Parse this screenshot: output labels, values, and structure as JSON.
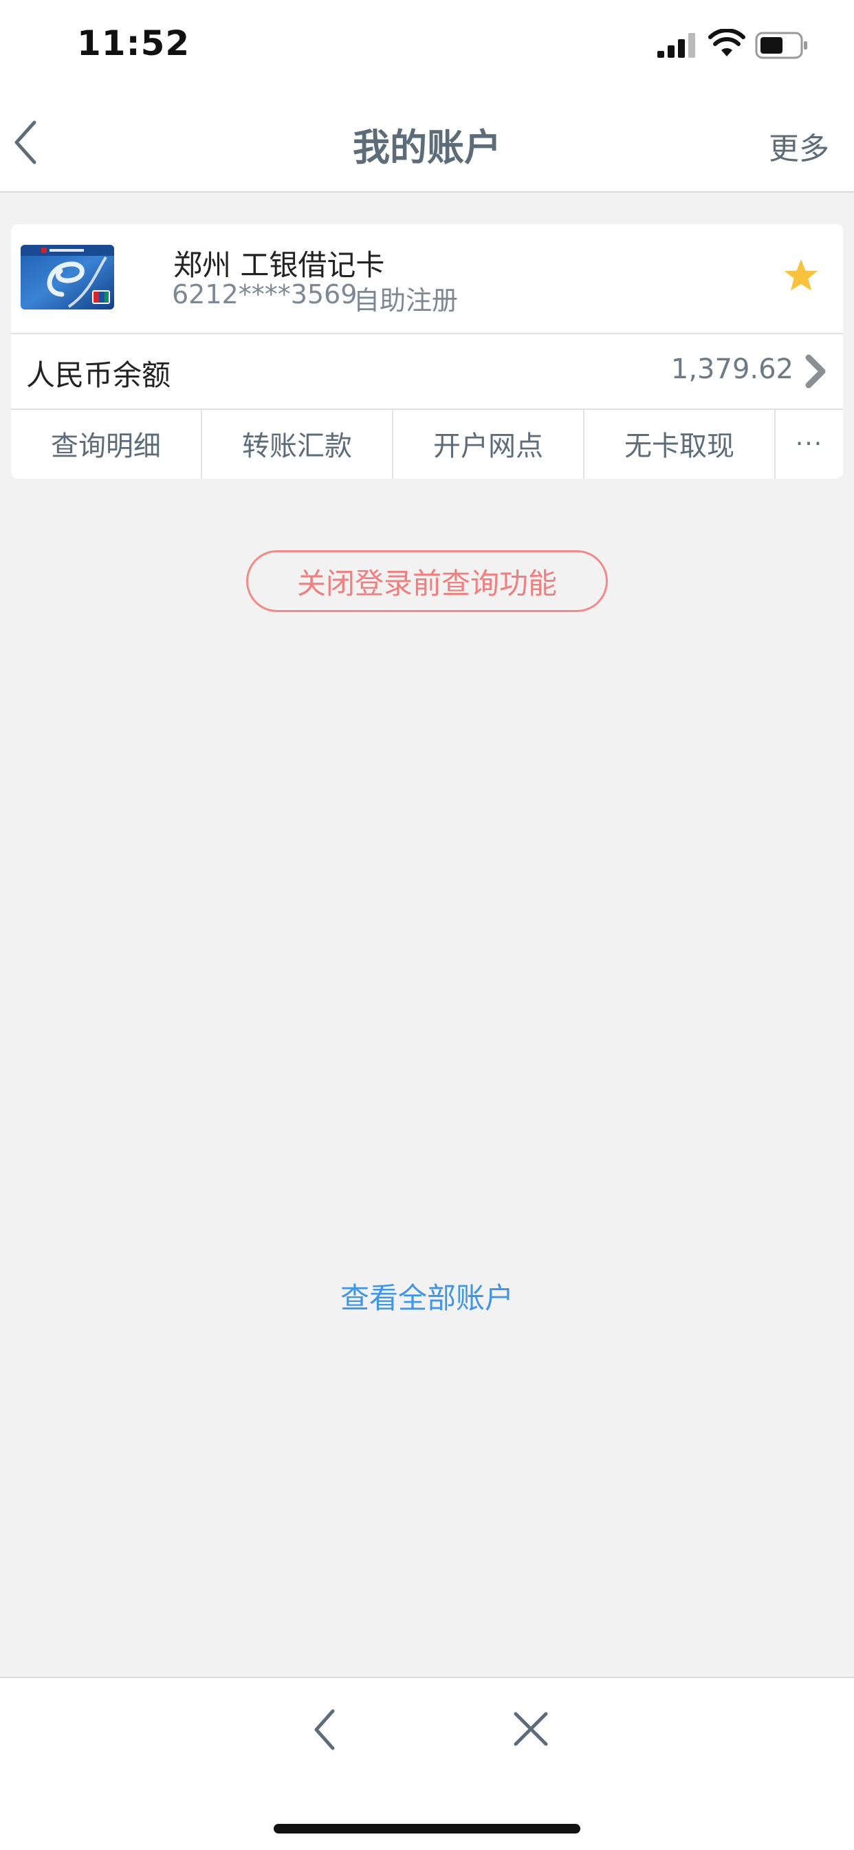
{
  "status_bar": {
    "time": "11:52"
  },
  "header": {
    "title": "我的账户",
    "more_label": "更多"
  },
  "account_card": {
    "name": "郑州 工银借记卡",
    "number": "6212****3569",
    "registration": "自助注册",
    "favorite": true,
    "balance_label": "人民币余额",
    "balance_value": "1,379.62",
    "actions": [
      {
        "label": "查询明细"
      },
      {
        "label": "转账汇款"
      },
      {
        "label": "开户网点"
      },
      {
        "label": "无卡取现"
      },
      {
        "label": "···"
      }
    ]
  },
  "close_query_button": "关闭登录前查询功能",
  "view_all_link": "查看全部账户",
  "icons": {
    "back": "chevron-left-icon",
    "favorite": "star-icon",
    "bottom_back": "chevron-left-icon",
    "bottom_close": "close-icon"
  },
  "colors": {
    "accent_blue": "#3f96e6",
    "warning_red": "#f07f7f",
    "star_yellow": "#f9c23c",
    "title_gray": "#5d6c79"
  }
}
